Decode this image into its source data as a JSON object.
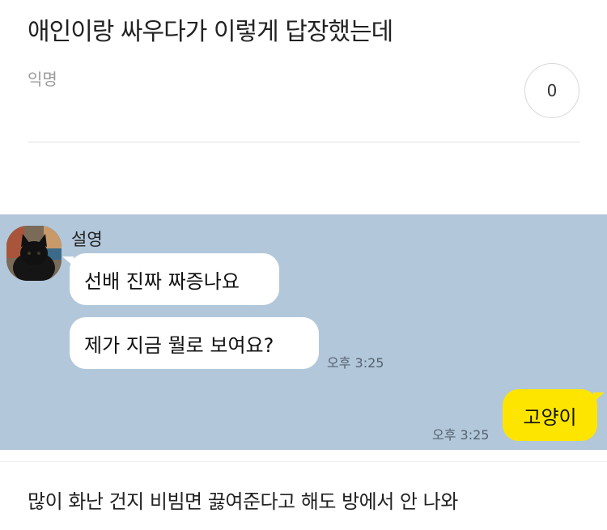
{
  "post": {
    "title": "애인이랑 싸우다가 이렇게 답장했는데",
    "author": "익명",
    "like_count": "0"
  },
  "chat": {
    "background_color": "#b2c7da",
    "sender_name": "설영",
    "messages": [
      {
        "from": "other",
        "text": "선배 진짜 짜증나요"
      },
      {
        "from": "other",
        "text": "제가 지금 뭘로 보여요?",
        "time": "오후 3:25"
      },
      {
        "from": "me",
        "text": "고양이",
        "time": "오후 3:25"
      }
    ],
    "my_bubble_color": "#fee500"
  },
  "body": {
    "text": "많이 화난 건지 비빔면 끓여준다고 해도 방에서 안 나와"
  }
}
